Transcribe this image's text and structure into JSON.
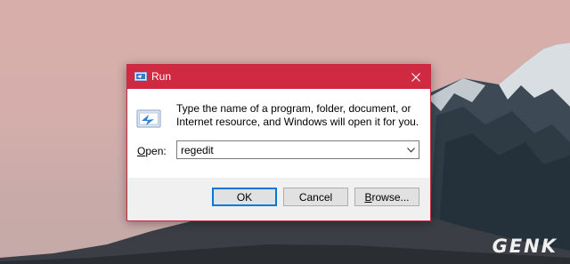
{
  "dialog": {
    "title": "Run",
    "description": "Type the name of a program, folder, document, or Internet resource, and Windows will open it for you.",
    "open_label_accel": "O",
    "open_label_rest": "pen:",
    "open_value": "regedit",
    "ok_label": "OK",
    "cancel_label": "Cancel",
    "browse_accel": "B",
    "browse_rest": "rowse..."
  },
  "watermark": {
    "text": "GENK"
  },
  "colors": {
    "titlebar": "#cf2a42",
    "accent": "#0078d7"
  }
}
